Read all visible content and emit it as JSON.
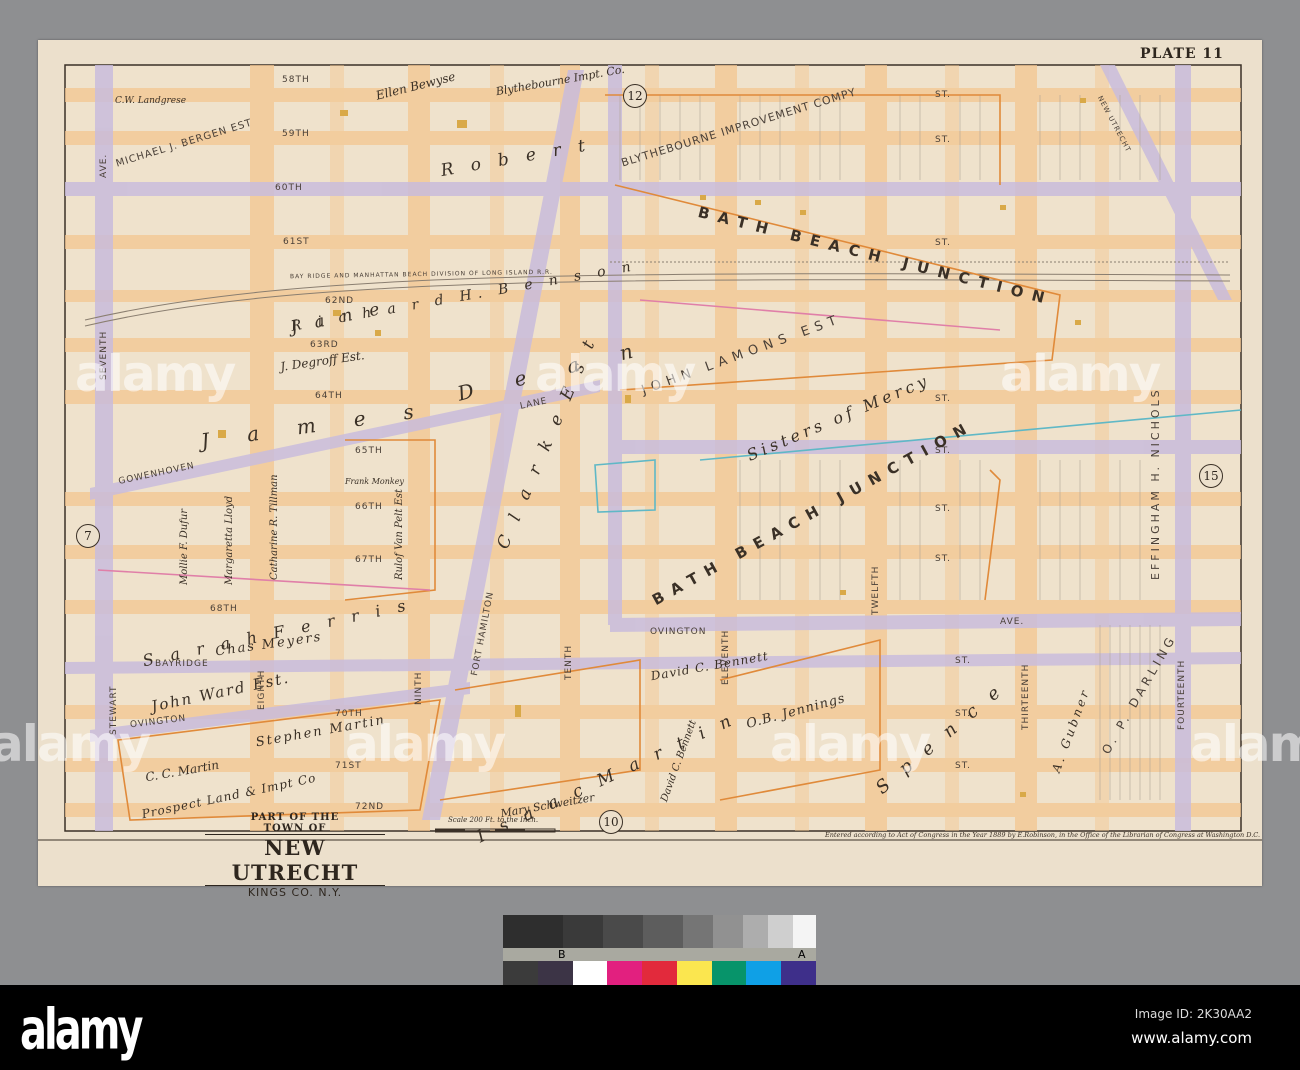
{
  "plate": "PLATE 11",
  "sheet_refs": {
    "top": "12",
    "bottom": "10",
    "left": "7",
    "right": "15"
  },
  "title": {
    "line1": "PART OF THE",
    "line2": "TOWN OF",
    "main": "NEW UTRECHT",
    "sub": "KINGS CO. N.Y."
  },
  "scale_text": "Scale 200 Ft. to the Inch.",
  "credit": "Entered according to Act of Congress in the Year 1889 by E.Robinson, in the Office of the Librarian of Congress at Washington D.C.",
  "streets": {
    "s58": "58TH",
    "s59": "59TH",
    "s60": "60TH",
    "s61": "61ST",
    "s62": "62ND",
    "s63": "63RD",
    "s64": "64TH",
    "s65": "65TH",
    "s66": "66TH",
    "s67": "67TH",
    "s68": "68TH",
    "s70": "70TH",
    "s71": "71ST",
    "s72": "72ND",
    "st": "ST.",
    "ave": "AVE.",
    "seventh": "SEVENTH",
    "eighth": "EIGHTH",
    "ninth": "NINTH",
    "fort_hamilton": "FORT HAMILTON",
    "tenth": "TENTH",
    "eleventh": "ELEVENTH",
    "twelfth": "TWELFTH",
    "thirteenth": "THIRTEENTH",
    "fourteenth": "FOURTEENTH",
    "ovington": "OVINGTON",
    "bayridge": "BAYRIDGE",
    "gowenhoven": "GOWENHOVEN",
    "lane": "LANE",
    "stewart": "STEWART",
    "new_utrecht": "NEW UTRECHT",
    "railroad": "BAY RIDGE AND MANHATTAN BEACH DIVISION OF LONG ISLAND R.R."
  },
  "owners": {
    "bath_beach_1": "BATH BEACH JUNCTION",
    "bath_beach_2": "BATH BEACH JUNCTION",
    "blythebourne": "BLYTHEBOURNE IMPROVEMENT COMPY",
    "blythebourne_impt": "Blythebourne Impt. Co.",
    "ellen_bergen": "Ellen Bewyse",
    "michael_bergen": "MICHAEL J. BERGEN EST",
    "landgrese": "C.W. Landgrese",
    "robert": "R o b e r t",
    "james": "J a m e s",
    "jane": "J a n e",
    "richard_benson": "R i c h a r d  H.  B e n s o n",
    "degroff": "J. Degroff Est.",
    "dean": "D e a n",
    "clarke": "C l a r k e  E s t",
    "sisters": "Sisters of Mercy",
    "john_lamon": "JOHN LAMONS EST",
    "effingham": "EFFINGHAM H. NICHOLS",
    "sarah_ferris": "S a r a h  F e r r i s",
    "chas_meyers": "Chas Meyers",
    "john_ward": "John Ward Est.",
    "cc_martin": "C. C. Martin",
    "stephen_martin": "Stephen Martin",
    "prospect": "Prospect Land & Impt Co",
    "isaac_martin": "I s a a c  M a r t i n",
    "mary_schweitzer": "Mary Schweitzer",
    "david_bennett": "David C. Bennett",
    "david_bennett_2": "David C. Bennett",
    "jennings": "O.B. Jennings",
    "spence": "S p e n c e",
    "gubner": "A. Gubner",
    "darling": "O. P. DARLING",
    "catharine": "Catharine R. Tillman",
    "margaretta": "Margaretta Lloyd",
    "mollie": "Mollie F. Dufur",
    "rulof": "Rulof Van Pelt Est",
    "frank": "Frank Monkey"
  },
  "watermark": {
    "brand": "alamy",
    "image_id": "Image ID: 2K30AA2",
    "url": "www.alamy.com"
  },
  "color_checker": {
    "label_b": "B",
    "label_a": "A",
    "swatches": [
      "#3b3b3b",
      "#3c3446",
      "#ffffff",
      "#e2207f",
      "#e22a3c",
      "#fbe64f",
      "#07946a",
      "#0fa0e6",
      "#3e2f8a"
    ]
  }
}
